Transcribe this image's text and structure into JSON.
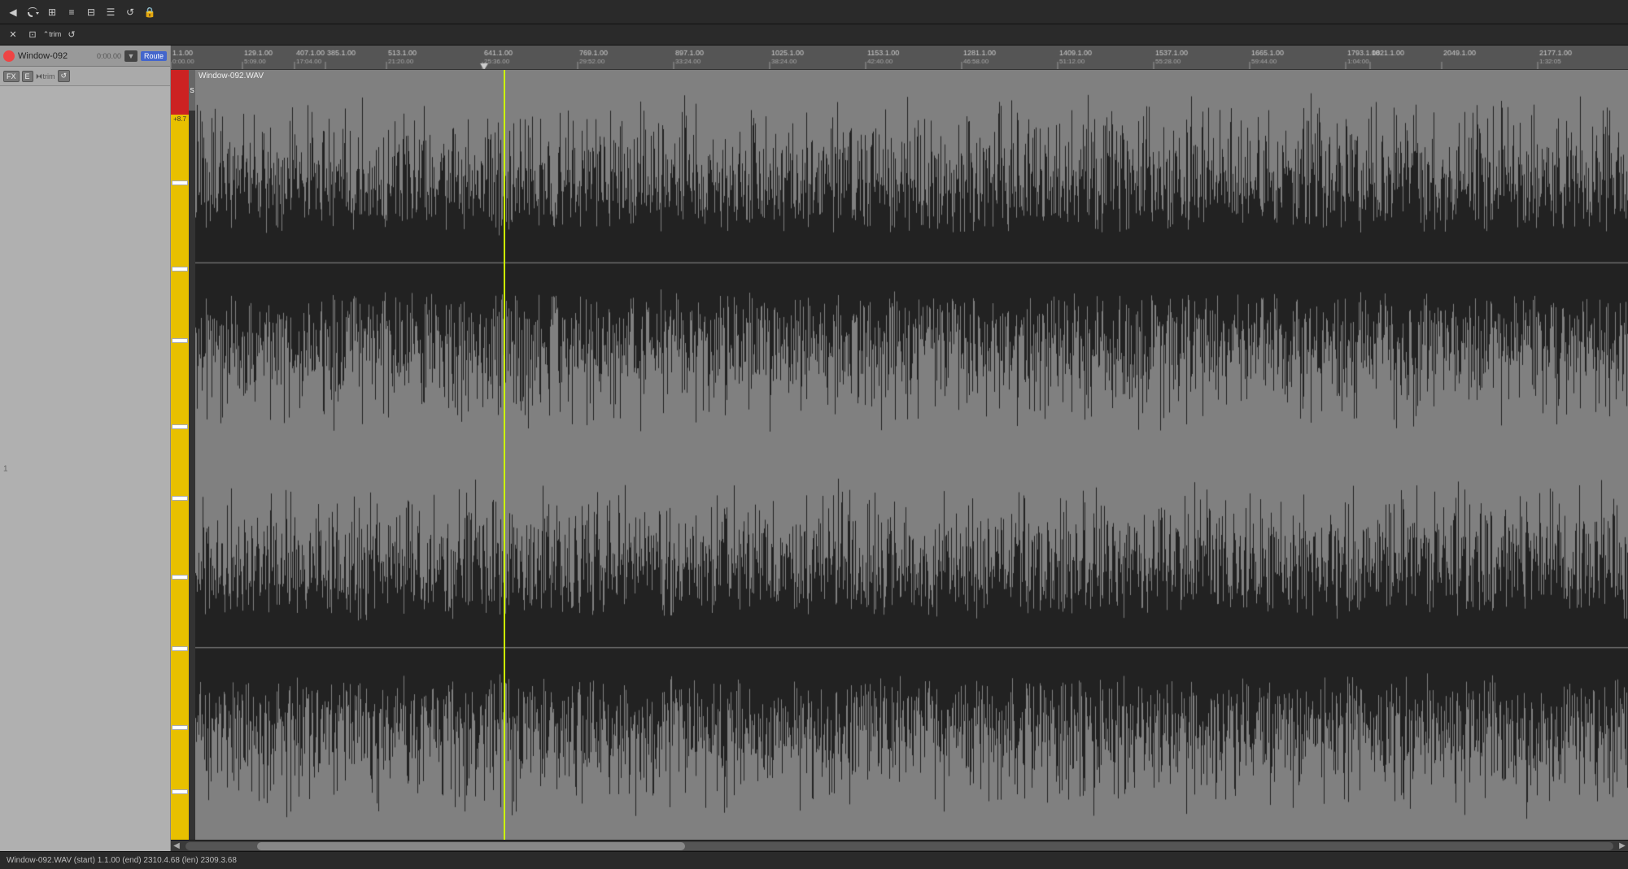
{
  "toolbar": {
    "icons": [
      "↩",
      "↪",
      "⊕",
      "≡",
      "⊞",
      "☰",
      "↺",
      "⛓"
    ],
    "icons2": [
      "✕",
      "⊡",
      "⌃trim",
      "↺"
    ],
    "title": ""
  },
  "track": {
    "name": "Window-092",
    "time": "0:00.00",
    "route_label": "Route",
    "volume_label": "+8.7",
    "s_label": "S",
    "fx_label": "FX",
    "env_label": "E",
    "trim_label": "trim"
  },
  "ruler": {
    "ticks": [
      {
        "label": "1.1.00",
        "sub": "0:00.00",
        "pos": 0
      },
      {
        "label": "129.1.00",
        "sub": "5:09.00",
        "pos": 128
      },
      {
        "label": "407.1.00",
        "sub": "17:04.00",
        "pos": 256
      },
      {
        "label": "385.1.00",
        "sub": "",
        "pos": 290
      },
      {
        "label": "513.1.00",
        "sub": "21:20.00",
        "pos": 380
      },
      {
        "label": "641.1.00",
        "sub": "25:36.00",
        "pos": 510
      },
      {
        "label": "769.1.00",
        "sub": "29:52.00",
        "pos": 638
      },
      {
        "label": "897.1.00",
        "sub": "33:24.00",
        "pos": 766
      },
      {
        "label": "1025.1.00",
        "sub": "38:24.00",
        "pos": 894
      },
      {
        "label": "1153.1.00",
        "sub": "42:40.00",
        "pos": 1022
      },
      {
        "label": "1281.1.00",
        "sub": "46:58.00",
        "pos": 1150
      },
      {
        "label": "1409.1.00",
        "sub": "51:12.00",
        "pos": 1278
      },
      {
        "label": "1537.1.00",
        "sub": "55:28.00",
        "pos": 1406
      },
      {
        "label": "1665.1.00",
        "sub": "59:44.00",
        "pos": 1534
      },
      {
        "label": "1793.1.00",
        "sub": "1:04:00",
        "pos": 1662
      },
      {
        "label": "1821.1.00",
        "sub": "",
        "pos": 1720
      },
      {
        "label": "2049.1.00",
        "sub": "",
        "pos": 1848
      },
      {
        "label": "2177.1.00",
        "sub": "1:32:05",
        "pos": 1976
      }
    ]
  },
  "waveform": {
    "file_name": "Window-092.WAV",
    "playhead_pos_percent": 21.5
  },
  "statusbar": {
    "text1": "Window-092.WAV (start) 1.1.00 (end) 2310.4.68 (len) 2309.3.68",
    "triangle_pos": ""
  },
  "scrollbar": {
    "thumb_left_percent": 5,
    "thumb_width_percent": 30
  }
}
